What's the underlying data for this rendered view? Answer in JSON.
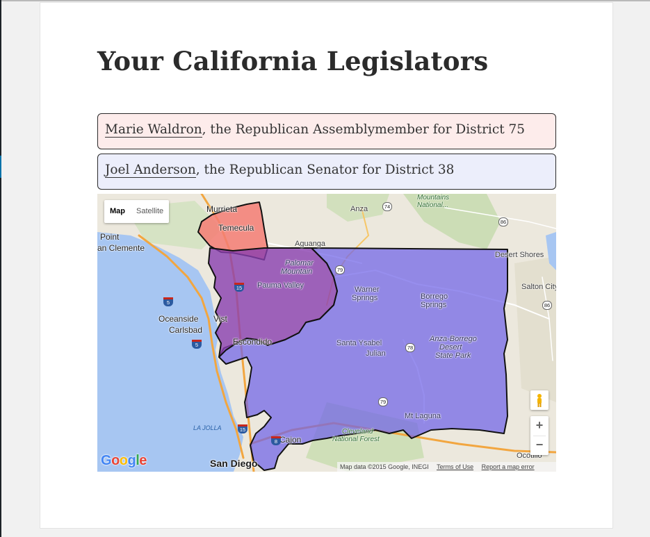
{
  "page": {
    "title": "Your California Legislators"
  },
  "legislators": [
    {
      "name": "Marie Waldron",
      "description": ", the Republican Assemblymember for District 75",
      "background_color": "#fdeceb"
    },
    {
      "name": "Joel Anderson",
      "description": ", the Republican Senator for District 38",
      "background_color": "#eceefb"
    }
  ],
  "map": {
    "type_controls": [
      "Map",
      "Satellite"
    ],
    "active_type": "Map",
    "zoom_in": "+",
    "zoom_out": "−",
    "logo": [
      "G",
      "o",
      "o",
      "g",
      "l",
      "e"
    ],
    "attribution": {
      "data": "Map data ©2015 Google, INEGI",
      "terms": "Terms of Use",
      "report": "Report a map error"
    },
    "district_colors": {
      "assembly": "#f47d74",
      "senate": "#6f62e8",
      "overlap": "#8a3fb0",
      "ocean": "#a7c6f2"
    },
    "places": {
      "murrieta": "Murrieta",
      "temecula": "Temecula",
      "anza": "Anza",
      "mountains": "Mountains",
      "national": "National...",
      "point": "Point",
      "san_clemente": "an Clemente",
      "aguanga": "Aguanga",
      "desert_shores": "Desert Shores",
      "palomar": "Palomar",
      "mountain": "Mountain",
      "pauma": "Pauma Valley",
      "warner": "Warner",
      "springs": "Springs",
      "borrego": "Borrego",
      "borrego_springs": "Springs",
      "salton": "Salton City",
      "oceanside": "Oceanside",
      "vista": "Vist",
      "carlsbad": "Carlsbad",
      "escondido": "Escondido",
      "santa_ysabel": "Santa Ysabel",
      "julian": "Julian",
      "anza_borrego": "Anza-Borrego",
      "desert": "Desert",
      "state_park": "State Park",
      "mt_laguna": "Mt Laguna",
      "la_jolla": "LA JOLLA",
      "cajon": "Cajon",
      "cleveland": "Cleveland",
      "national_forest": "National Forest",
      "san_diego": "San Diego",
      "ocotillo": "Ocotillo"
    },
    "route_shields": {
      "r74": "74",
      "r86a": "86",
      "r79a": "79",
      "r86b": "86",
      "r78": "78",
      "r79b": "79",
      "i15a": "15",
      "i5a": "5",
      "i5b": "5",
      "i15b": "15",
      "i8": "8"
    }
  }
}
